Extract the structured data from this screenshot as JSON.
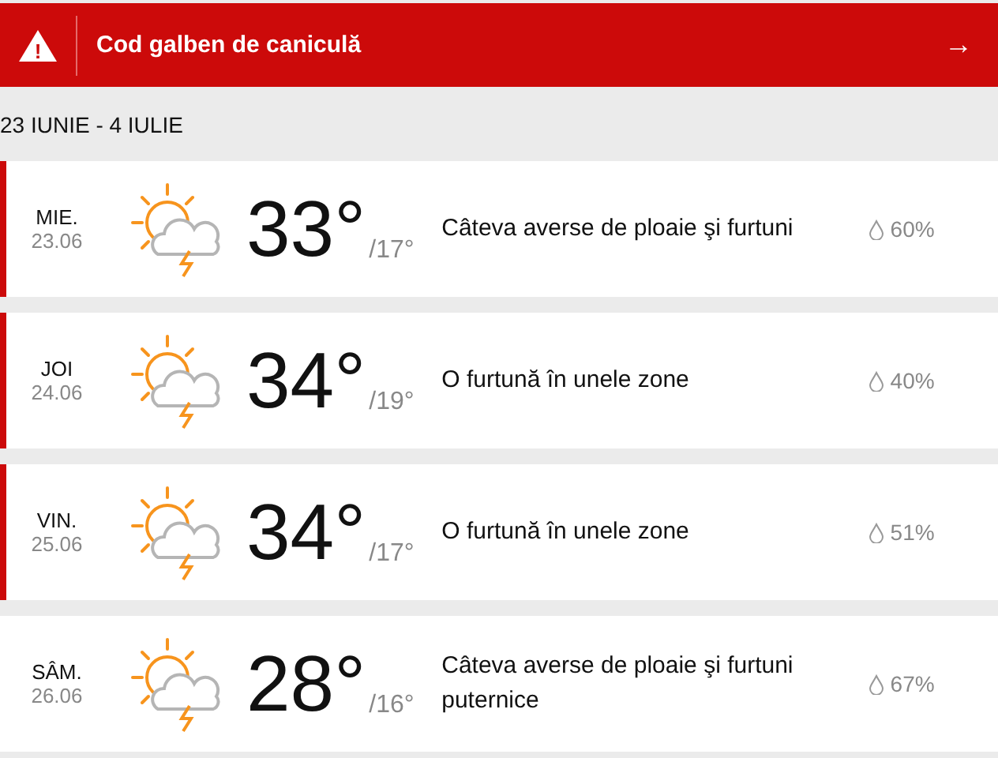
{
  "alert": {
    "icon": "!",
    "title": "Cod galben de caniculă",
    "arrow": "→"
  },
  "range": "23 IUNIE - 4 IULIE",
  "days": [
    {
      "day": "MIE.",
      "date": "23.06",
      "high": "33°",
      "low": "/17°",
      "text": "Câteva averse de ploaie şi furtuni",
      "precip": "60%",
      "alert": true
    },
    {
      "day": "JOI",
      "date": "24.06",
      "high": "34°",
      "low": "/19°",
      "text": "O furtună în unele zone",
      "precip": "40%",
      "alert": true
    },
    {
      "day": "VIN.",
      "date": "25.06",
      "high": "34°",
      "low": "/17°",
      "text": "O furtună în unele zone",
      "precip": "51%",
      "alert": true
    },
    {
      "day": "SÂM.",
      "date": "26.06",
      "high": "28°",
      "low": "/16°",
      "text": "Câteva averse de ploaie şi furtuni puternice",
      "precip": "67%",
      "alert": false
    }
  ]
}
